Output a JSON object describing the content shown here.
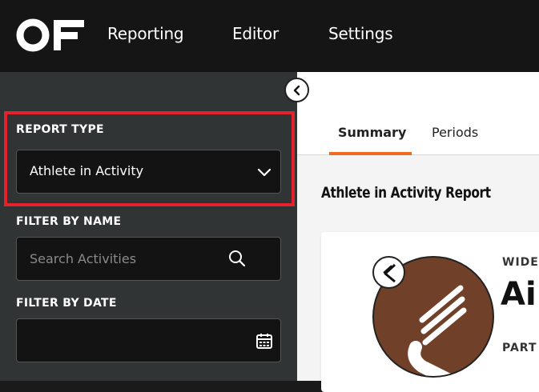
{
  "app": {
    "logo_text": "OF",
    "nav": [
      "Reporting",
      "Editor",
      "Settings"
    ]
  },
  "sidebar": {
    "report_type": {
      "label": "REPORT TYPE",
      "selected": "Athlete in Activity"
    },
    "filter_name": {
      "label": "FILTER BY NAME",
      "placeholder": "Search Activities",
      "value": ""
    },
    "filter_date": {
      "label": "FILTER BY DATE",
      "value": ""
    }
  },
  "main": {
    "tabs": [
      {
        "label": "Summary",
        "active": true
      },
      {
        "label": "Periods",
        "active": false
      }
    ],
    "report_title": "Athlete in Activity Report",
    "card": {
      "top_label": "WIDE",
      "name": "Ai",
      "sub_label": "PART"
    }
  },
  "colors": {
    "topbar": "#151515",
    "sidebar": "#303435",
    "highlight": "#e5212b",
    "accent": "#f26a1b",
    "avatar_bg": "#704128"
  }
}
